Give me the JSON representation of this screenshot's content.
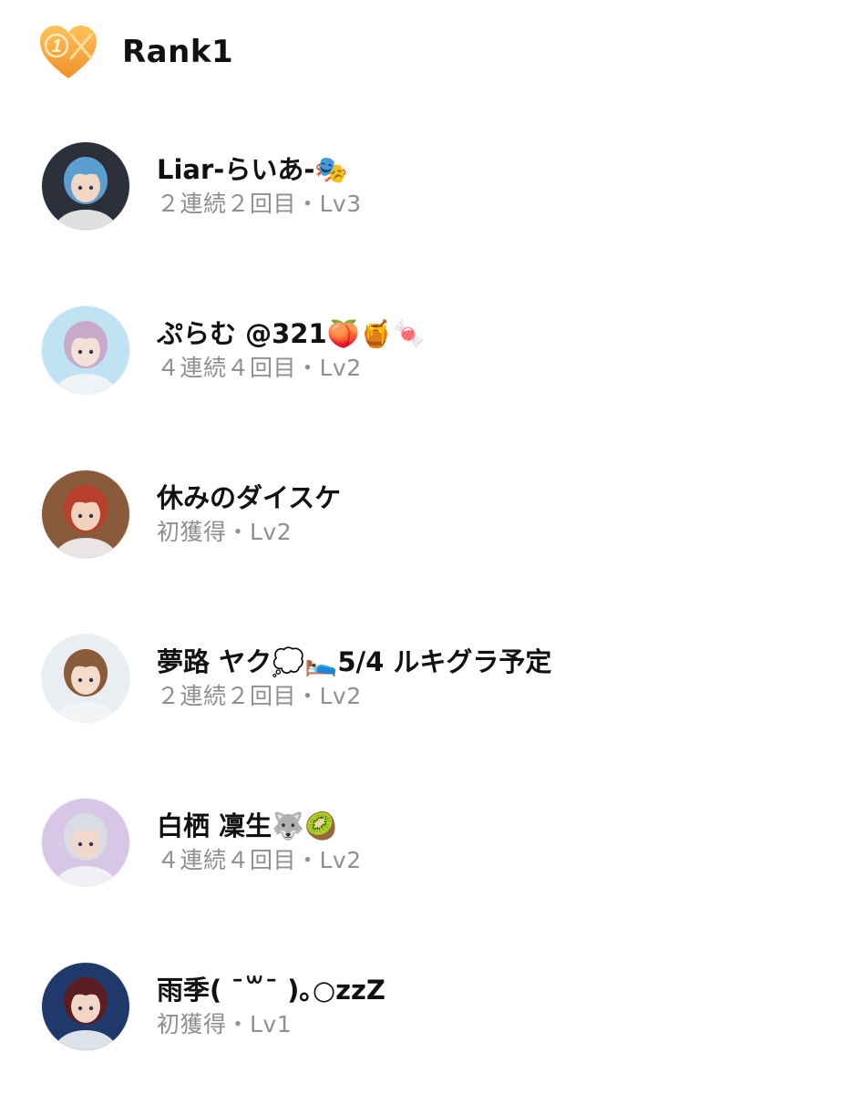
{
  "header": {
    "badge_text": "1",
    "title": "Rank1",
    "badge_color": "#f4a93a"
  },
  "users": [
    {
      "name": "Liar-らいあ-🎭",
      "status": "２連続２回目・Lv3",
      "avatar_bg": "#2c2f3a",
      "avatar_hair": "#5a9fd0",
      "avatar_skin": "#f2d6c6"
    },
    {
      "name": "ぷらむ @321🍑🍯🍬",
      "status": "４連続４回目・Lv2",
      "avatar_bg": "#bfe3f2",
      "avatar_hair": "#c7a9c9",
      "avatar_skin": "#f3e0d8"
    },
    {
      "name": "休みのダイスケ",
      "status": "初獲得・Lv2",
      "avatar_bg": "#8a5a3c",
      "avatar_hair": "#b8402c",
      "avatar_skin": "#f2d2bc"
    },
    {
      "name": "夢路 ヤク💭🛌5/4 ルキグラ予定",
      "status": "２連続２回目・Lv2",
      "avatar_bg": "#e9eef2",
      "avatar_hair": "#8a5a3a",
      "avatar_skin": "#f4dccb"
    },
    {
      "name": "白栖 凜生🐺🥝",
      "status": "４連続４回目・Lv2",
      "avatar_bg": "#d8c6e6",
      "avatar_hair": "#d9dde3",
      "avatar_skin": "#f0d8cc"
    },
    {
      "name": "雨季(  ˉ꒳ˉ )｡○zzZ",
      "status": "初獲得・Lv1",
      "avatar_bg": "#1f3a6a",
      "avatar_hair": "#5a1e22",
      "avatar_skin": "#f2d6c8"
    }
  ]
}
